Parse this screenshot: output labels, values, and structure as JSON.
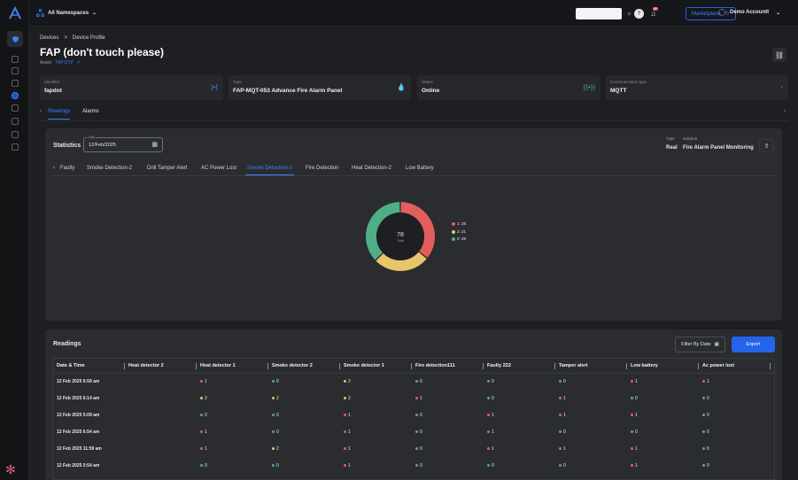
{
  "topbar": {
    "namespace": "All Namespaces",
    "notif_count": "9+",
    "marketplace_label": "Marketplace",
    "user_name": "Demo Accountt"
  },
  "breadcrumb": {
    "root": "Devices",
    "separator": ">",
    "current": "Device Profile"
  },
  "page": {
    "title": "FAP (don't touch please)",
    "asset_label": "Asset:",
    "asset_link": "TAP DTP"
  },
  "cards": [
    {
      "label": "Identifier",
      "value": "fapdot",
      "icon": "identifier-icon"
    },
    {
      "label": "Type",
      "value": "FAP-MQT-053 Advance Fire Alarm Panel",
      "icon": "drop-icon"
    },
    {
      "label": "Status",
      "value": "Online",
      "icon": "signal-icon"
    },
    {
      "label": "Communication type",
      "value": "MQTT",
      "icon": "connection-icon"
    }
  ],
  "tabs_top": {
    "readings": "Readings",
    "alarms": "Alarms"
  },
  "statistics": {
    "title": "Statistics",
    "date_label": "Day",
    "date_value": "12/Feb/2025",
    "type_label": "Type",
    "type_value": "Real",
    "solution_label": "Solution",
    "solution_value": "Fire Alarm Panel Monitoring",
    "subtabs": [
      "Faulty",
      "Smoke Detection-2",
      "Drill Tamper Alert",
      "AC Power Lost",
      "Smoke Detection-1",
      "Fire Detection",
      "Heat Detection-2",
      "Low Battery"
    ],
    "active_subtab": "Smoke Detection-1"
  },
  "chart_data": {
    "type": "pie",
    "center_value": "78",
    "center_label": "Total",
    "slices": [
      {
        "name": "1: 28",
        "value": 28,
        "color": "#e35d5d"
      },
      {
        "name": "2: 21",
        "value": 21,
        "color": "#e8c46a"
      },
      {
        "name": "0: 29",
        "value": 29,
        "color": "#4fae84"
      }
    ]
  },
  "readings": {
    "title": "Readings",
    "filter_label": "Filter By Date",
    "export_label": "Export",
    "columns": [
      "Date & Time",
      "Heat detector 2",
      "Heat detector 1",
      "Smoke detector 2",
      "Smoke detector 1",
      "Fire detection111",
      "Faulty 222",
      "Tamper alert",
      "Low battery",
      "Ac power lost"
    ],
    "rows": [
      [
        "12 Feb 2025 6:59 am",
        "",
        "1",
        "0",
        "2",
        "0",
        "0",
        "0",
        "1",
        "1"
      ],
      [
        "12 Feb 2025 6:14 am",
        "",
        "2",
        "2",
        "2",
        "1",
        "0",
        "1",
        "0",
        "0"
      ],
      [
        "12 Feb 2025 5:09 am",
        "",
        "0",
        "0",
        "1",
        "0",
        "1",
        "1",
        "1",
        "0"
      ],
      [
        "12 Feb 2025 6:54 am",
        "",
        "1",
        "0",
        "1",
        "0",
        "1",
        "0",
        "0",
        "0"
      ],
      [
        "12 Feb 2025 11:59 am",
        "",
        "1",
        "2",
        "1",
        "0",
        "1",
        "1",
        "1",
        "0"
      ],
      [
        "12 Feb 2025 5:54 am",
        "",
        "0",
        "0",
        "1",
        "0",
        "0",
        "0",
        "1",
        "0"
      ]
    ]
  },
  "colors": {
    "accent": "#2563eb",
    "red": "#e35d5d",
    "green": "#4fae84",
    "yellow": "#e8c46a"
  }
}
